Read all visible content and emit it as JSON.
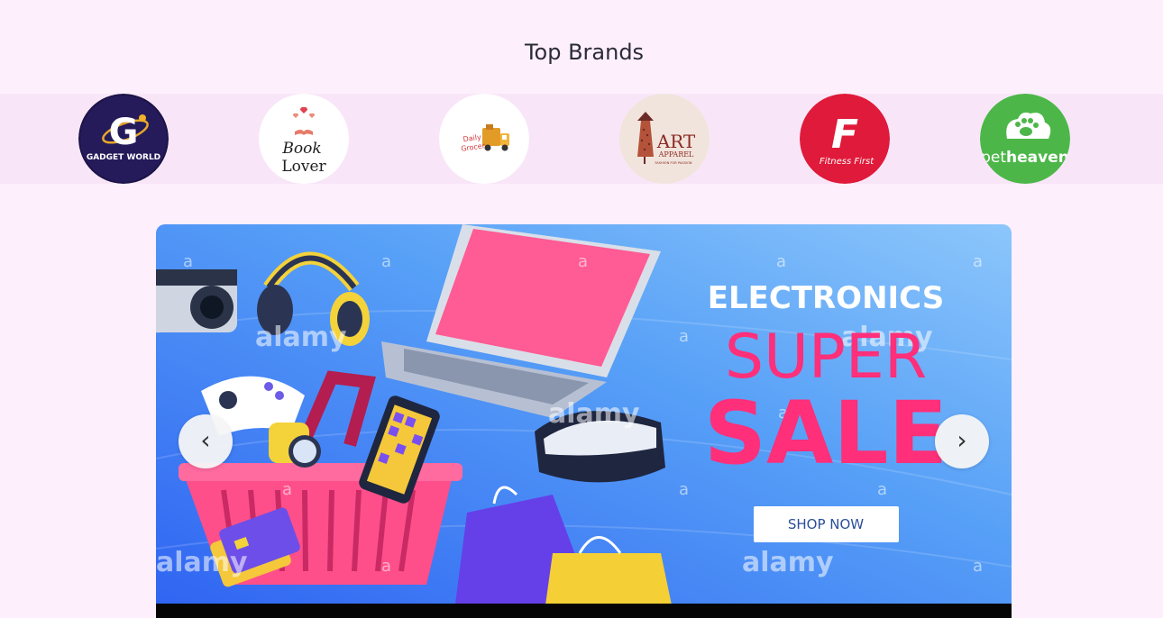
{
  "section": {
    "title": "Top Brands"
  },
  "brands": [
    {
      "name": "GADGET WORLD",
      "logo_letter": "G",
      "bg": "#1a1440",
      "icon": "gadget-world-logo"
    },
    {
      "name_line1": "Book",
      "name_line2": "Lover",
      "bg": "#ffffff",
      "icon": "book-lover-logo"
    },
    {
      "name_line1": "Daily",
      "name_line2": "Grocer",
      "bg": "#ffffff",
      "icon": "daily-grocer-truck-logo"
    },
    {
      "name_line1": "ART",
      "name_line2": "APPAREL",
      "tagline": "FASHION FOR PASSION",
      "bg": "#f1e4dc",
      "icon": "art-apparel-logo"
    },
    {
      "logo_letter": "F",
      "name": "Fitness First",
      "bg": "#e01a3a",
      "icon": "fitness-first-logo"
    },
    {
      "name_pre": "pet",
      "name_post": "heaven",
      "bg": "#4cb748",
      "icon": "pet-heaven-paw-logo"
    }
  ],
  "banner": {
    "line1": "ELECTRONICS",
    "line2": "SUPER",
    "line3": "SALE",
    "cta": "SHOP NOW",
    "watermark": "alamy",
    "watermark_small": "a"
  },
  "carousel": {
    "prev_label": "‹",
    "next_label": "›"
  },
  "colors": {
    "page_bg": "#fdf0fc",
    "strip_bg": "#f8e6f8",
    "banner_blue": "#4a8df5",
    "sale_pink": "#ff2f7a"
  }
}
